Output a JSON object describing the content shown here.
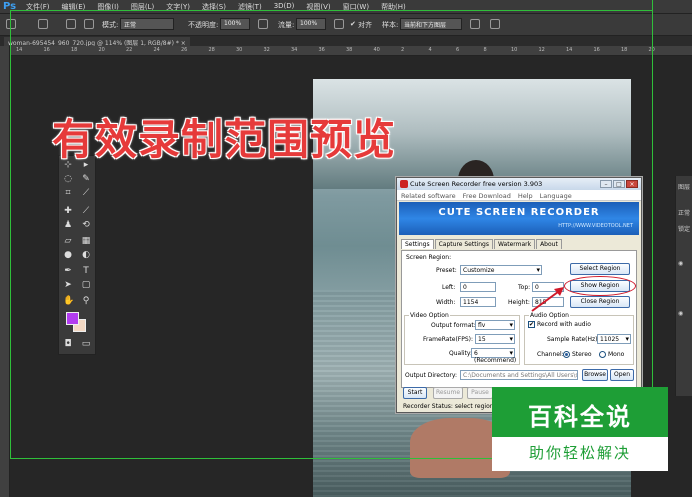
{
  "app": {
    "logo": "Ps",
    "menu": [
      "文件(F)",
      "编辑(E)",
      "图像(I)",
      "图层(L)",
      "文字(Y)",
      "选择(S)",
      "滤镜(T)",
      "3D(D)",
      "视图(V)",
      "窗口(W)",
      "帮助(H)"
    ]
  },
  "options": {
    "mode_label": "模式:",
    "mode_value": "正常",
    "opacity_label": "不透明度:",
    "opacity_value": "100%",
    "flow_label": "流量:",
    "flow_value": "100%",
    "align_label": "对齐",
    "sample_label": "样本:",
    "sample_value": "当前和下方图层"
  },
  "document": {
    "tab_label": "woman-695454_960_720.jpg @ 114% (图层 1, RGB/8#) *",
    "ruler_ticks": [
      "14",
      "16",
      "18",
      "20",
      "22",
      "24",
      "26",
      "28",
      "30",
      "32",
      "34",
      "36",
      "38",
      "40",
      "2",
      "4",
      "6",
      "8",
      "10",
      "12",
      "14",
      "16",
      "18",
      "20"
    ]
  },
  "caption": "有效录制范围预览",
  "right_panel": [
    "图层",
    "正常",
    "锁定"
  ],
  "recorder": {
    "title": "Cute Screen Recorder free version 3.903",
    "menu": [
      "Related software",
      "Free Download",
      "Help",
      "Language"
    ],
    "banner_title": "CUTE SCREEN RECORDER",
    "banner_url": "HTTP://WWW.VIDEOTOOL.NET",
    "tabs": [
      "Settings",
      "Capture Settings",
      "Watermark",
      "About"
    ],
    "screen_region": {
      "title": "Screen Region:",
      "preset_label": "Preset:",
      "preset_value": "Customize",
      "left_label": "Left:",
      "left_value": "0",
      "top_label": "Top:",
      "top_value": "0",
      "width_label": "Width:",
      "width_value": "1154",
      "height_label": "Height:",
      "height_value": "815",
      "select_btn": "Select Region",
      "show_btn": "Show Region",
      "close_btn": "Close Region"
    },
    "video": {
      "title": "Video Option",
      "format_label": "Output format:",
      "format_value": "flv",
      "fps_label": "FrameRate(FPS):",
      "fps_value": "15",
      "quality_label": "Quality:",
      "quality_value": "6 (Recommend)"
    },
    "audio": {
      "title": "Audio Option",
      "record_label": "Record with audio",
      "rate_label": "Sample Rate(Hz):",
      "rate_value": "11025",
      "channel_label": "Channel:",
      "stereo_label": "Stereo",
      "mono_label": "Mono"
    },
    "output": {
      "label": "Output Directory:",
      "value": "C:\\Documents and Settings\\All Users\\scre",
      "browse": "Browse",
      "open": "Open"
    },
    "controls": [
      "Start",
      "Resume",
      "Pause"
    ],
    "status": "Recorder Status: select region 115"
  },
  "watermark": {
    "title": "百科全说",
    "subtitle": "助你轻松解决"
  }
}
